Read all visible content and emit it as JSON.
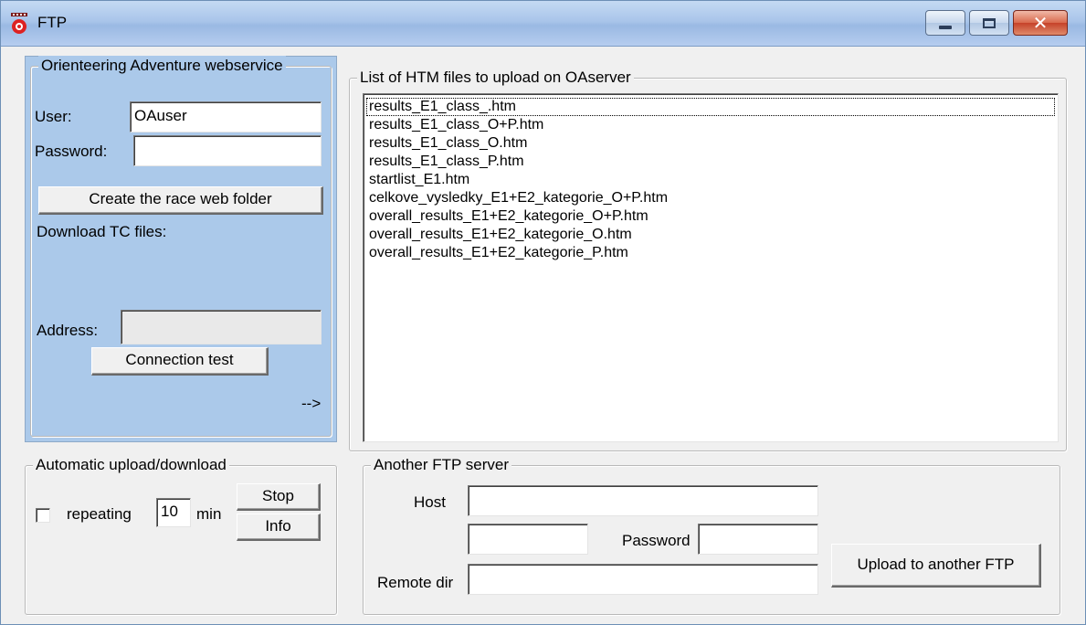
{
  "window": {
    "title": "FTP"
  },
  "oa_panel": {
    "legend": "Orienteering Adventure webservice",
    "user_label": "User:",
    "user_value": "OAuser",
    "password_label": "Password:",
    "password_value": "",
    "create_folder_button": "Create the race web folder",
    "download_label": "Download TC files:",
    "address_label": "Address:",
    "address_value": "",
    "connection_test_button": "Connection test",
    "arrow_text": "-->"
  },
  "files": {
    "legend": "List of HTM files to upload on OAserver",
    "items": [
      "results_E1_class_.htm",
      "results_E1_class_O+P.htm",
      "results_E1_class_O.htm",
      "results_E1_class_P.htm",
      "startlist_E1.htm",
      "celkove_vysledky_E1+E2_kategorie_O+P.htm",
      "overall_results_E1+E2_kategorie_O+P.htm",
      "overall_results_E1+E2_kategorie_O.htm",
      "overall_results_E1+E2_kategorie_P.htm"
    ]
  },
  "auto": {
    "legend": "Automatic upload/download",
    "repeating_label": "repeating",
    "interval_value": "10",
    "min_label": "min",
    "stop_button": "Stop",
    "info_button": "Info"
  },
  "another_ftp": {
    "legend": "Another FTP server",
    "host_label": "Host",
    "host_value": "",
    "user_value": "",
    "password_label": "Password",
    "password_value": "",
    "remote_dir_label": "Remote dir",
    "remote_dir_value": "",
    "upload_button": "Upload to another FTP"
  },
  "colors": {
    "panel_blue": "#abc9ea",
    "window_bg": "#f0f0f0",
    "title_gradient": "#a9c5ea",
    "close_red": "#c5422a"
  }
}
